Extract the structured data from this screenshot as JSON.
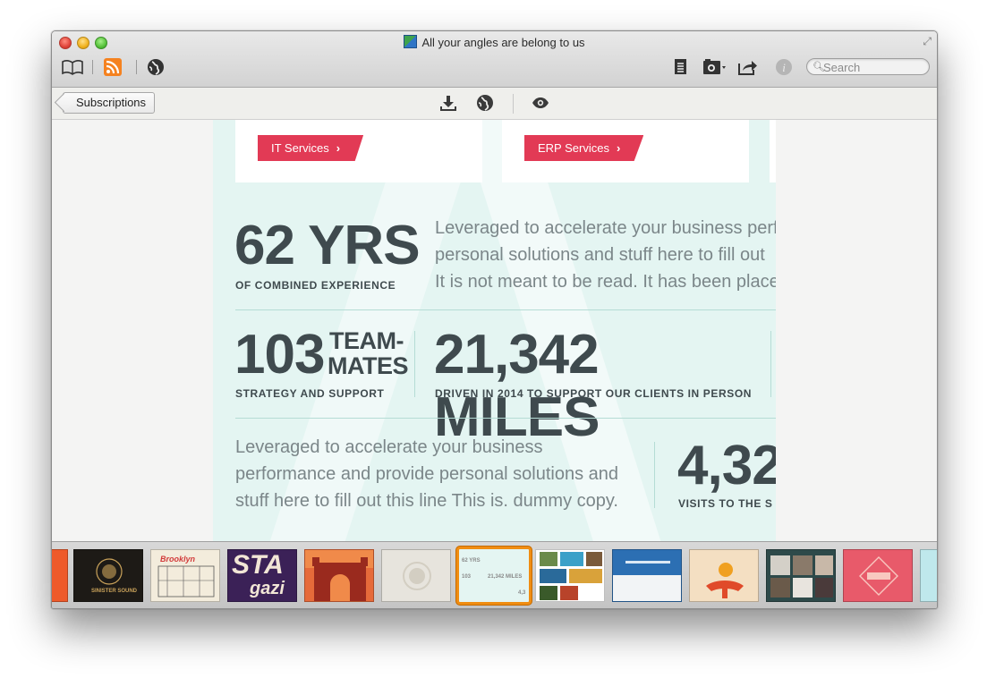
{
  "window": {
    "title": "All your angles are belong to us"
  },
  "toolbar": {
    "search_placeholder": "Search"
  },
  "subbar": {
    "back_label": "Subscriptions"
  },
  "article": {
    "services": [
      {
        "label": "IT Services",
        "chevron": "›"
      },
      {
        "label": "ERP Services",
        "chevron": "›"
      }
    ],
    "stat1": {
      "value": "62 YRS",
      "caption": "OF COMBINED EXPERIENCE"
    },
    "paragraph1": [
      "Leveraged to accelerate your business perf",
      "personal solutions and stuff here to fill out",
      "It is not meant to be read. It has been place"
    ],
    "stat2": {
      "value": "103",
      "word_top": "TEAM-",
      "word_bottom": "MATES",
      "caption": "STRATEGY AND SUPPORT"
    },
    "stat3": {
      "value": "21,342 MILES",
      "caption": "DRIVEN IN 2014 TO SUPPORT OUR CLIENTS IN PERSON"
    },
    "paragraph2": [
      "Leveraged to accelerate your business",
      "performance and provide personal solutions and",
      "stuff here to fill out this line This is. dummy copy."
    ],
    "stat4": {
      "value": "4,32",
      "caption": "VISITS TO THE S"
    },
    "colors": {
      "accent": "#e23a55",
      "text_dark": "#3f4a4e",
      "text_light": "#7b8689",
      "background": "#e4f5f2",
      "selection": "#f08d12"
    }
  },
  "filmstrip": {
    "selected_thumb": {
      "line1": "62 YRS",
      "line2a": "103",
      "line2b": "21,342 MILES",
      "line3": "4,3"
    },
    "thumbs": [
      {
        "name": "orange"
      },
      {
        "name": "sinister-sound",
        "label": "SINISTER SOUND"
      },
      {
        "name": "brooklyn",
        "label": "Brooklyn"
      },
      {
        "name": "stay-gazi",
        "label_top": "STA",
        "label_bottom": "gazi"
      },
      {
        "name": "india-gate"
      },
      {
        "name": "emblem"
      },
      {
        "name": "article-selected"
      },
      {
        "name": "travel-collage"
      },
      {
        "name": "blue-site"
      },
      {
        "name": "hand-fruit"
      },
      {
        "name": "dark-gallery"
      },
      {
        "name": "pink-badge"
      },
      {
        "name": "teal-partial"
      }
    ]
  }
}
